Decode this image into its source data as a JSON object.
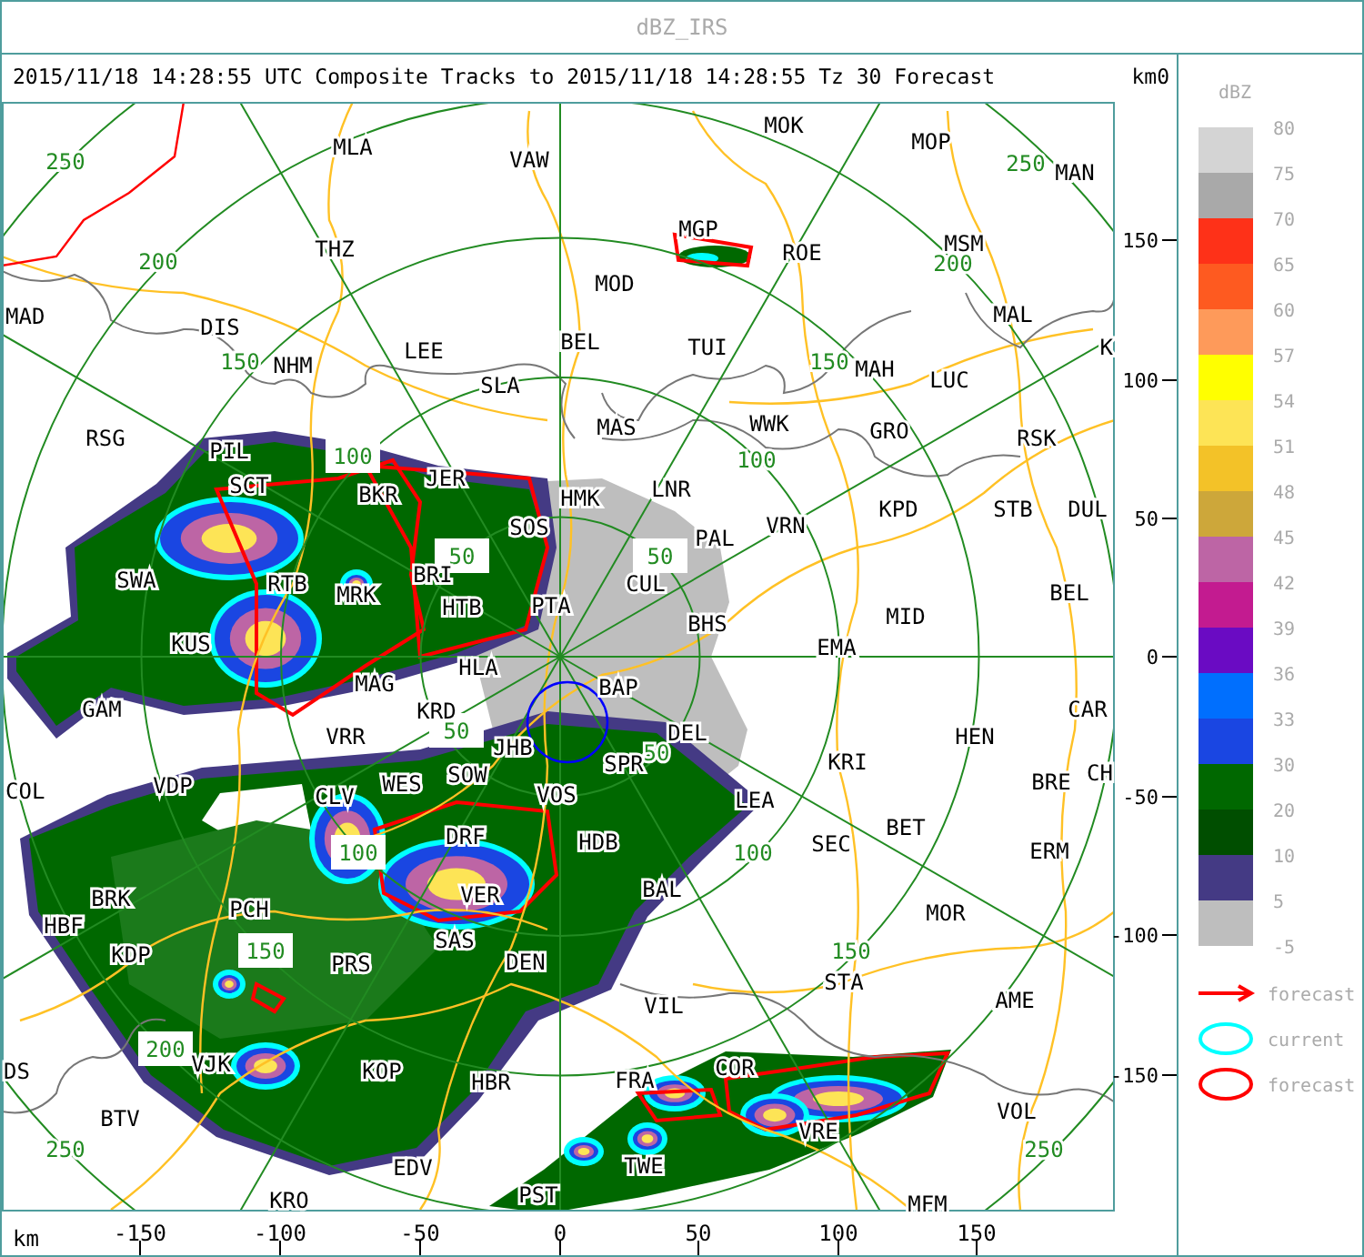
{
  "window": {
    "title": "dBZ_IRS"
  },
  "header": {
    "text": "2015/11/18 14:28:55 UTC Composite Tracks to 2015/11/18 14:28:55 Tz 30 Forecast",
    "axis_unit": "km0"
  },
  "map": {
    "stations": [
      "MOK",
      "MOP",
      "MLA",
      "VAW",
      "MAN",
      "THZ",
      "MGP",
      "MSM",
      "ROE",
      "MOD",
      "MAD",
      "DIS",
      "MAL",
      "LEE",
      "BEL",
      "TUI",
      "K",
      "NHM",
      "SLA",
      "MAH",
      "LUC",
      "RSG",
      "MAS",
      "WWK",
      "GRO",
      "RSK",
      "PIL",
      "SCT",
      "BKR",
      "JER",
      "HMK",
      "LNR",
      "SOS",
      "VRN",
      "KPD",
      "STB",
      "DUL",
      "PAL",
      "SWA",
      "RTB",
      "MRK",
      "BRI",
      "CUL",
      "BEL",
      "HTB",
      "PTA",
      "BHS",
      "MID",
      "KUS",
      "EMA",
      "MAG",
      "HLA",
      "BAP",
      "GAM",
      "KRD",
      "CAR",
      "VRR",
      "JHB",
      "DEL",
      "HEN",
      "SOW",
      "SPR",
      "KRI",
      "BRE",
      "CH",
      "COL",
      "VDP",
      "CLV",
      "WES",
      "VOS",
      "LEA",
      "DRF",
      "HDB",
      "SEC",
      "BET",
      "ERM",
      "BRK",
      "PCH",
      "VER",
      "BAL",
      "HBF",
      "MOR",
      "KDP",
      "SAS",
      "PRS",
      "DEN",
      "STA",
      "VIL",
      "AME",
      "DS",
      "VJK",
      "KOP",
      "HBR",
      "FRA",
      "COR",
      "BTV",
      "VRE",
      "VOL",
      "EDV",
      "TWE",
      "KRO",
      "PST",
      "MFM"
    ],
    "range_labels": [
      {
        "text": "250",
        "boxed": false
      },
      {
        "text": "200",
        "boxed": false
      },
      {
        "text": "150",
        "boxed": false
      },
      {
        "text": "100",
        "boxed": true
      },
      {
        "text": "50",
        "boxed": true
      },
      {
        "text": "250",
        "boxed": false
      },
      {
        "text": "200",
        "boxed": false
      },
      {
        "text": "150",
        "boxed": false
      },
      {
        "text": "100",
        "boxed": false
      },
      {
        "text": "50",
        "boxed": true
      },
      {
        "text": "50",
        "boxed": true
      },
      {
        "text": "100",
        "boxed": true
      },
      {
        "text": "150",
        "boxed": true
      },
      {
        "text": "200",
        "boxed": true
      },
      {
        "text": "250",
        "boxed": false
      },
      {
        "text": "50",
        "boxed": false
      },
      {
        "text": "100",
        "boxed": false
      },
      {
        "text": "150",
        "boxed": false
      },
      {
        "text": "250",
        "boxed": false
      }
    ],
    "x_axis": {
      "unit": "km",
      "ticks": [
        "-150",
        "-100",
        "-50",
        "0",
        "50",
        "100",
        "150"
      ]
    },
    "y_axis": {
      "ticks": [
        "150",
        "100",
        "50",
        "0",
        "-50",
        "-100",
        "-150"
      ]
    }
  },
  "legend": {
    "title": "dBZ",
    "scale": [
      {
        "label": "80",
        "color": "#d4d4d4"
      },
      {
        "label": "75",
        "color": "#a9a9a9"
      },
      {
        "label": "70",
        "color": "#fe3118"
      },
      {
        "label": "65",
        "color": "#fe5a20"
      },
      {
        "label": "60",
        "color": "#fe9a5a"
      },
      {
        "label": "57",
        "color": "#ffff00"
      },
      {
        "label": "54",
        "color": "#fde456"
      },
      {
        "label": "51",
        "color": "#f3c228"
      },
      {
        "label": "48",
        "color": "#cda73a"
      },
      {
        "label": "45",
        "color": "#bd65a5"
      },
      {
        "label": "42",
        "color": "#c31b90"
      },
      {
        "label": "39",
        "color": "#6a0bc3"
      },
      {
        "label": "36",
        "color": "#006ffe"
      },
      {
        "label": "33",
        "color": "#1a46e2"
      },
      {
        "label": "30",
        "color": "#006800"
      },
      {
        "label": "20",
        "color": "#004e00"
      },
      {
        "label": "10",
        "color": "#443a84"
      },
      {
        "label": "5",
        "color": "#bebebe"
      }
    ],
    "bottom_label": "-5",
    "symbols": [
      {
        "kind": "arrow",
        "label": "forecast",
        "color": "#ff0000"
      },
      {
        "kind": "ellipse",
        "label": "current",
        "color": "#00ffff"
      },
      {
        "kind": "ellipse",
        "label": "forecast",
        "color": "#ff0000"
      }
    ]
  }
}
